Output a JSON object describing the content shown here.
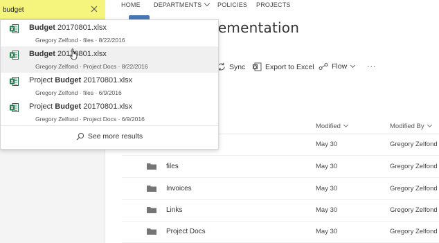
{
  "search": {
    "value": "budget"
  },
  "topnav": {
    "items": [
      "HOME",
      "DEPARTMENTS",
      "POLICIES",
      "PROJECTS"
    ]
  },
  "page": {
    "title": "nt Implementation"
  },
  "commands": {
    "sync": "Sync",
    "export": "Export to Excel",
    "flow": "Flow",
    "more": "···"
  },
  "results": [
    {
      "bold": "Budget",
      "rest": " 20170801.xlsx",
      "pre": "",
      "meta": "Gregory Zelfond · files · 8/22/2016"
    },
    {
      "bold": "Budget",
      "rest": " 20170801.xlsx",
      "pre": "",
      "meta": "Gregory Zelfond · Project Docs · 8/22/2016"
    },
    {
      "bold": "Budget",
      "rest": " 20170801.xlsx",
      "pre": "Project ",
      "meta": "Gregory Zelfond · files · 6/9/2016"
    },
    {
      "bold": "Budget",
      "rest": " 20170801.xlsx",
      "pre": "Project ",
      "meta": "Gregory Zelfond · Project Docs · 6/9/2016"
    }
  ],
  "see_more": "See more results",
  "table": {
    "headers": {
      "modified": "Modified",
      "modified_by": "Modified By"
    },
    "rows": [
      {
        "name": "",
        "modified": "May 30",
        "modified_by": "Gregory Zelfond"
      },
      {
        "name": "files",
        "modified": "May 30",
        "modified_by": "Gregory Zelfond"
      },
      {
        "name": "Invoices",
        "modified": "May 30",
        "modified_by": "Gregory Zelfond"
      },
      {
        "name": "Links",
        "modified": "May 30",
        "modified_by": "Gregory Zelfond"
      },
      {
        "name": "Project Docs",
        "modified": "May 30",
        "modified_by": "Gregory Zelfond"
      }
    ]
  },
  "colors": {
    "search_highlight": "#f5f57d",
    "excel_green": "#1e7145",
    "folder": "#757575"
  }
}
